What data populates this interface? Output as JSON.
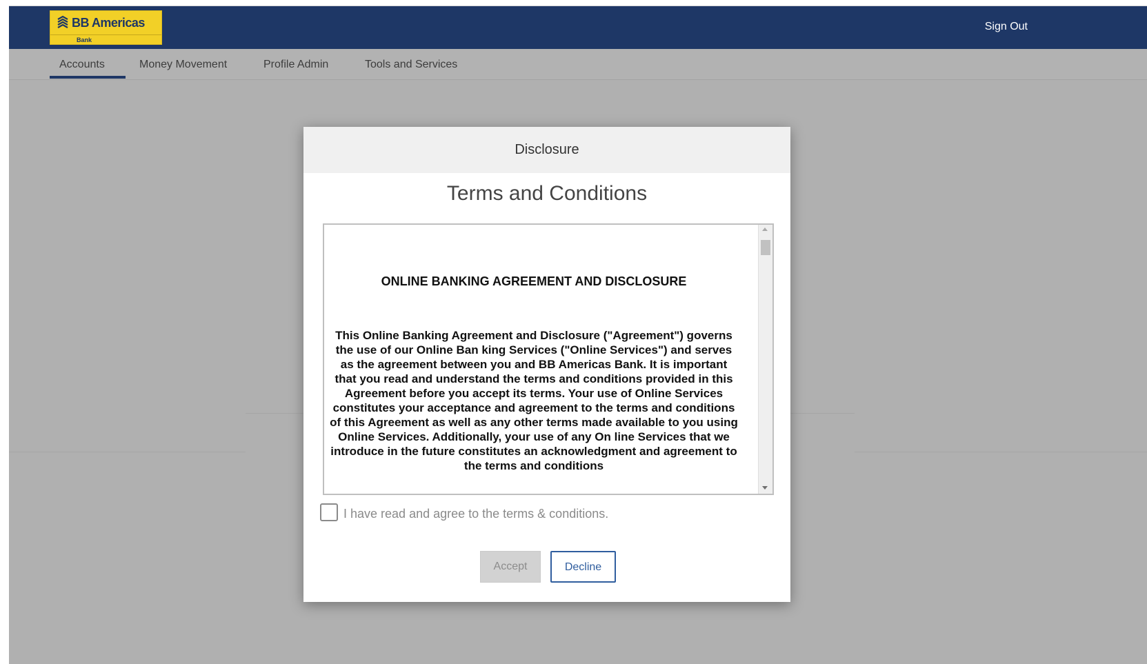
{
  "brand": {
    "name": "BB Americas",
    "sub": "Bank",
    "icon": "bb-logo-icon",
    "colors": {
      "header": "#1e3766",
      "logo_bg": "#f2d027",
      "accent": "#2f5d9e"
    }
  },
  "header": {
    "sign_out": "Sign Out"
  },
  "nav": {
    "items": [
      {
        "label": "Accounts",
        "active": true
      },
      {
        "label": "Money Movement",
        "active": false
      },
      {
        "label": "Profile Admin",
        "active": false
      },
      {
        "label": "Tools and Services",
        "active": false
      }
    ]
  },
  "modal": {
    "header_title": "Disclosure",
    "title": "Terms and Conditions",
    "document": {
      "heading": "ONLINE BANKING AGREEMENT AND DISCLOSURE",
      "body": "This Online Banking Agreement and Disclosure (\"Agreement\") governs the use of our Online Ban king Services (\"Online Services\") and serves as the agreement between you and BB Americas Bank. It is important that you read and understand the terms and conditions provided in this Agreement before you accept its terms. Your use of Online Services constitutes your acceptance and agreement to the terms and conditions of this Agreement as well as any other terms made available to you using Online Services. Additionally, your use of any On line Services that we introduce in the future constitutes an acknowledgment and agreement to the terms and conditions"
    },
    "agree_label": "I have read and agree to the terms & conditions.",
    "agree_checked": false,
    "accept_label": "Accept",
    "decline_label": "Decline"
  }
}
